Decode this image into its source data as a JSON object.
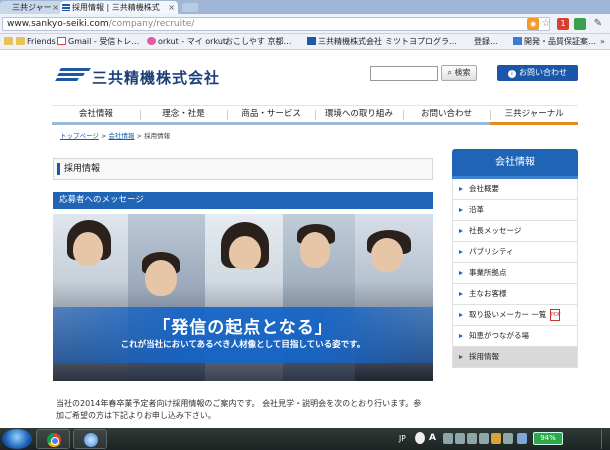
{
  "browser": {
    "tabs": [
      {
        "label": "三共ジャー",
        "close": "×"
      },
      {
        "label": "採用情報 | 三共精機株式",
        "close": "×"
      }
    ],
    "url_host": "www.sankyo-seiki.com",
    "url_path": "/company/recruite/",
    "ext_badge": "1",
    "bookmarks": [
      {
        "label": "",
        "icon": "folder-icon"
      },
      {
        "label": "Friends",
        "icon": "folder-icon"
      },
      {
        "label": "Gmail - 受信トレ…",
        "icon": "gmail-icon"
      },
      {
        "label": "orkut - マイ orkut",
        "icon": "orkut-icon"
      },
      {
        "label": "おこしやす 京都…",
        "icon": "page-icon"
      },
      {
        "label": "三共精機株式会社",
        "icon": "sankyo-icon"
      },
      {
        "label": "ミツトヨプログラ…",
        "icon": "page-icon"
      },
      {
        "label": "登録…",
        "icon": "page-icon"
      },
      {
        "label": "開発・品質保証案…",
        "icon": "docs-icon"
      }
    ],
    "bookmarks_more": "»"
  },
  "site": {
    "company_name": "三共精機株式会社",
    "search_button": "検索",
    "contact_button": "お問い合わせ",
    "nav": [
      "会社情報",
      "理念・社是",
      "商品・サービス",
      "環境への取り組み",
      "お問い合わせ",
      "三共ジャーナル"
    ],
    "breadcrumb": {
      "home": "トップページ",
      "sep1": " > ",
      "company": "会社情報",
      "sep2": " > ",
      "current": "採用情報"
    },
    "page_title": "採用情報",
    "section_title": "応募者へのメッセージ",
    "hero_title": "「発信の起点となる」",
    "hero_subtitle": "これが当社においてあるべき人材像として目指している姿です。",
    "intro_text": "当社の2014年春卒業予定者向け採用情報のご案内です。 会社見学・説明会を次のとおり行います。参加ご希望の方は下記よりお申し込み下さい。"
  },
  "sidebar": {
    "title": "会社情報",
    "items": [
      {
        "label": "会社概要"
      },
      {
        "label": "沿革"
      },
      {
        "label": "社長メッセージ"
      },
      {
        "label": "パブリシティ"
      },
      {
        "label": "事業所拠点"
      },
      {
        "label": "主なお客様"
      },
      {
        "label": "取り扱いメーカー 一覧"
      },
      {
        "label": "知恵がつながる場"
      },
      {
        "label": "採用情報"
      }
    ],
    "active_index": 8
  },
  "taskbar": {
    "lang": "JP",
    "ime": "A",
    "battery": "94%",
    "date_lines": [
      "",
      ""
    ]
  },
  "colors": {
    "brand_blue": "#1f64b5",
    "journal_orange": "#e38a26"
  }
}
